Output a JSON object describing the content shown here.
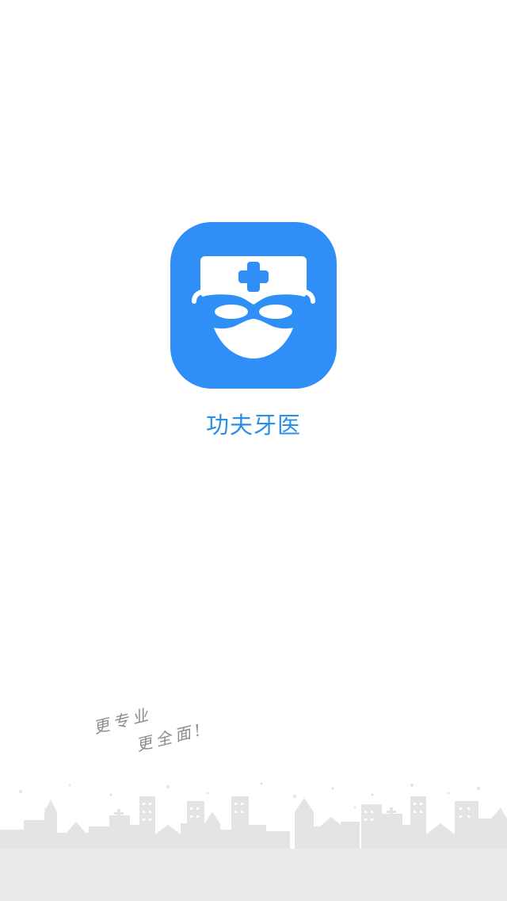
{
  "splash": {
    "app_name": "功夫牙医",
    "slogan_line1": "更专业",
    "slogan_line2": "更全面!"
  },
  "icons": {
    "app_logo": "dentist-mask-cross-icon"
  },
  "colors": {
    "brand_blue": "#2f8ff7",
    "title_blue": "#2a8fe8",
    "skyline_gray": "#e6e6e6",
    "ground_gray": "#ebebeb",
    "background": "#ffffff"
  }
}
